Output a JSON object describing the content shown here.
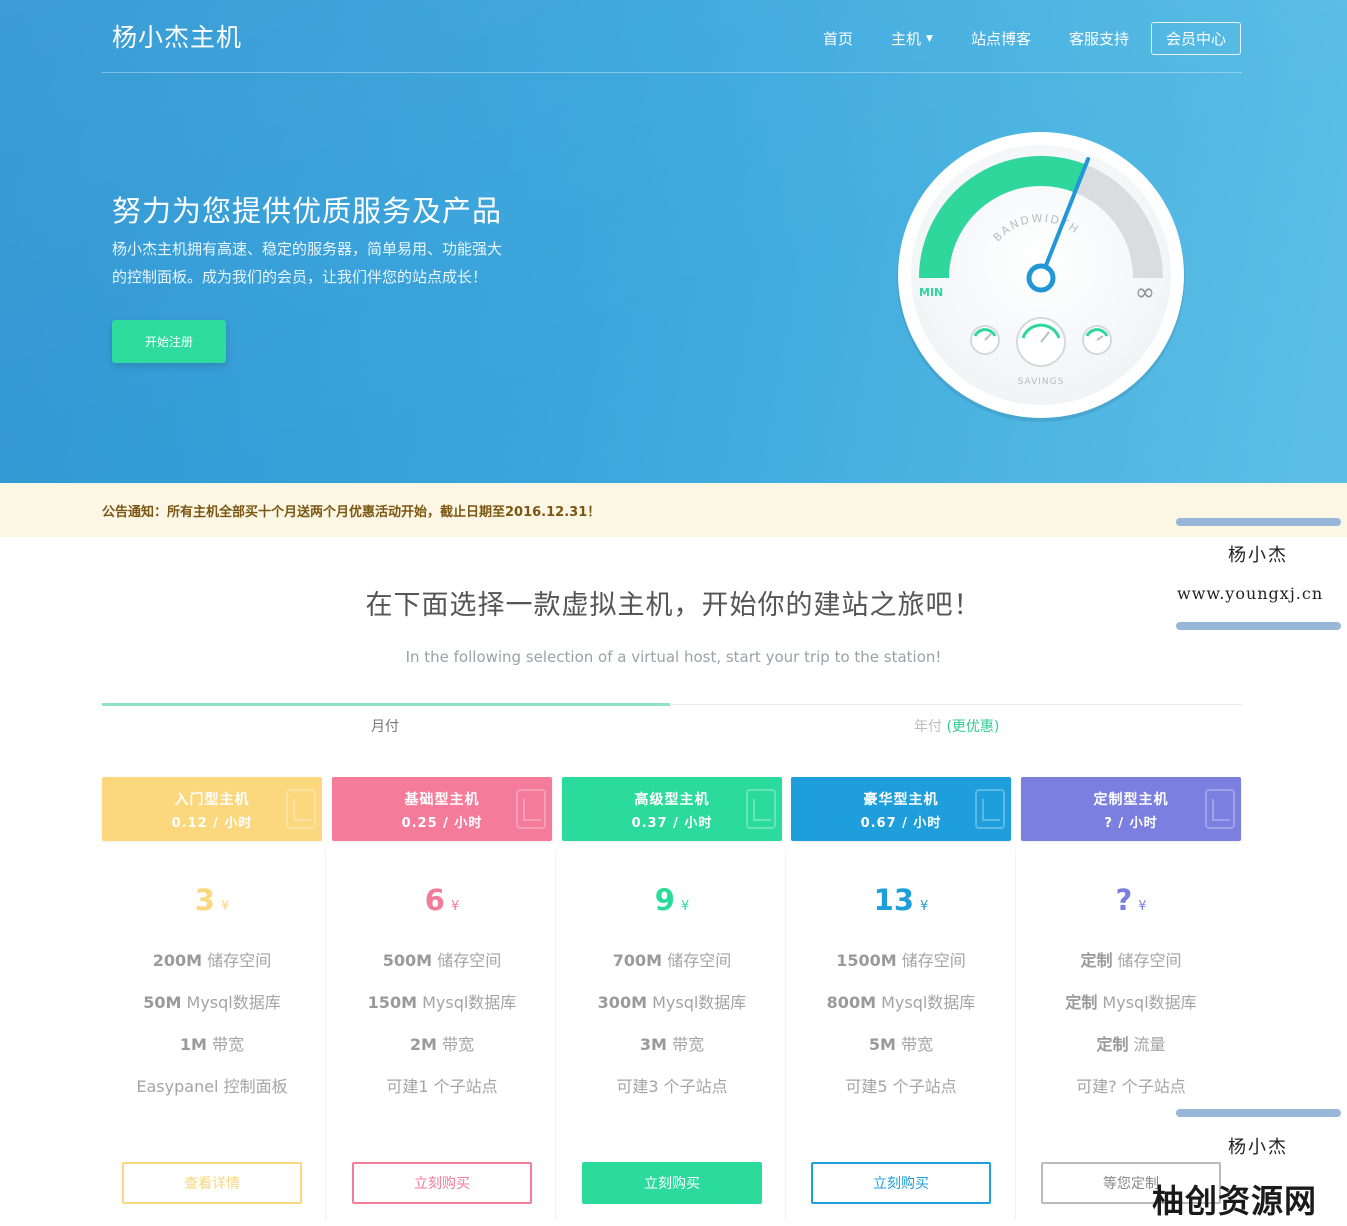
{
  "header": {
    "brand": "杨小杰主机",
    "nav": {
      "home": "首页",
      "hosting": "主机",
      "blog": "站点博客",
      "support": "客服支持",
      "member": "会员中心"
    }
  },
  "hero": {
    "title": "努力为您提供优质服务及产品",
    "desc_line1": "杨小杰主机拥有高速、稳定的服务器，简单易用、功能强大",
    "desc_line2": "的控制面板。成为我们的会员，让我们伴您的站点成长！",
    "cta": "开始注册"
  },
  "gauge": {
    "label_bandwidth": "BANDWIDTH",
    "label_min": "MIN",
    "label_max": "∞",
    "label_savings": "SAVINGS",
    "level": 0.62
  },
  "notice": "公告通知：所有主机全部买十个月送两个月优惠活动开始，截止日期至2016.12.31！",
  "section": {
    "title": "在下面选择一款虚拟主机，开始你的建站之旅吧！",
    "subtitle": "In the following selection of a virtual host, start your trip to the station!"
  },
  "tabs": {
    "monthly": "月付",
    "yearly": "年付",
    "yearly_hint": "(更优惠)"
  },
  "plans": [
    {
      "name": "入门型主机",
      "rate": "0.12 / 小时",
      "price": "3",
      "currency": "¥",
      "f1_strong": "200M",
      "f1_rest": " 储存空间",
      "f2_strong": "50M",
      "f2_rest": " Mysql数据库",
      "f3_strong": "1M",
      "f3_rest": " 带宽",
      "f4": "Easypanel 控制面板",
      "button": "查看详情",
      "color": "#fbd77d"
    },
    {
      "name": "基础型主机",
      "rate": "0.25 / 小时",
      "price": "6",
      "currency": "¥",
      "f1_strong": "500M",
      "f1_rest": " 储存空间",
      "f2_strong": "150M",
      "f2_rest": " Mysql数据库",
      "f3_strong": "2M",
      "f3_rest": " 带宽",
      "f4": "可建1 个子站点",
      "button": "立刻购买",
      "color": "#f47b9a"
    },
    {
      "name": "高级型主机",
      "rate": "0.37 / 小时",
      "price": "9",
      "currency": "¥",
      "f1_strong": "700M",
      "f1_rest": " 储存空间",
      "f2_strong": "300M",
      "f2_rest": " Mysql数据库",
      "f3_strong": "3M",
      "f3_rest": " 带宽",
      "f4": "可建3 个子站点",
      "button": "立刻购买",
      "color": "#2bdb9b"
    },
    {
      "name": "豪华型主机",
      "rate": "0.67 / 小时",
      "price": "13",
      "currency": "¥",
      "f1_strong": "1500M",
      "f1_rest": " 储存空间",
      "f2_strong": "800M",
      "f2_rest": " Mysql数据库",
      "f3_strong": "5M",
      "f3_rest": " 带宽",
      "f4": "可建5 个子站点",
      "button": "立刻购买",
      "color": "#1e9fdc"
    },
    {
      "name": "定制型主机",
      "rate": "? / 小时",
      "price": "?",
      "currency": "¥",
      "f1_strong": "定制",
      "f1_rest": " 储存空间",
      "f2_strong": "定制",
      "f2_rest": " Mysql数据库",
      "f3_strong": "定制",
      "f3_rest": " 流量",
      "f4": "可建? 个子站点",
      "button": "等您定制",
      "color": "#7b7fe0"
    }
  ],
  "watermark": {
    "name": "杨小杰",
    "url": "www.youngxj.cn",
    "site": "柚创资源网",
    "bar_color": "#98b7d8"
  }
}
